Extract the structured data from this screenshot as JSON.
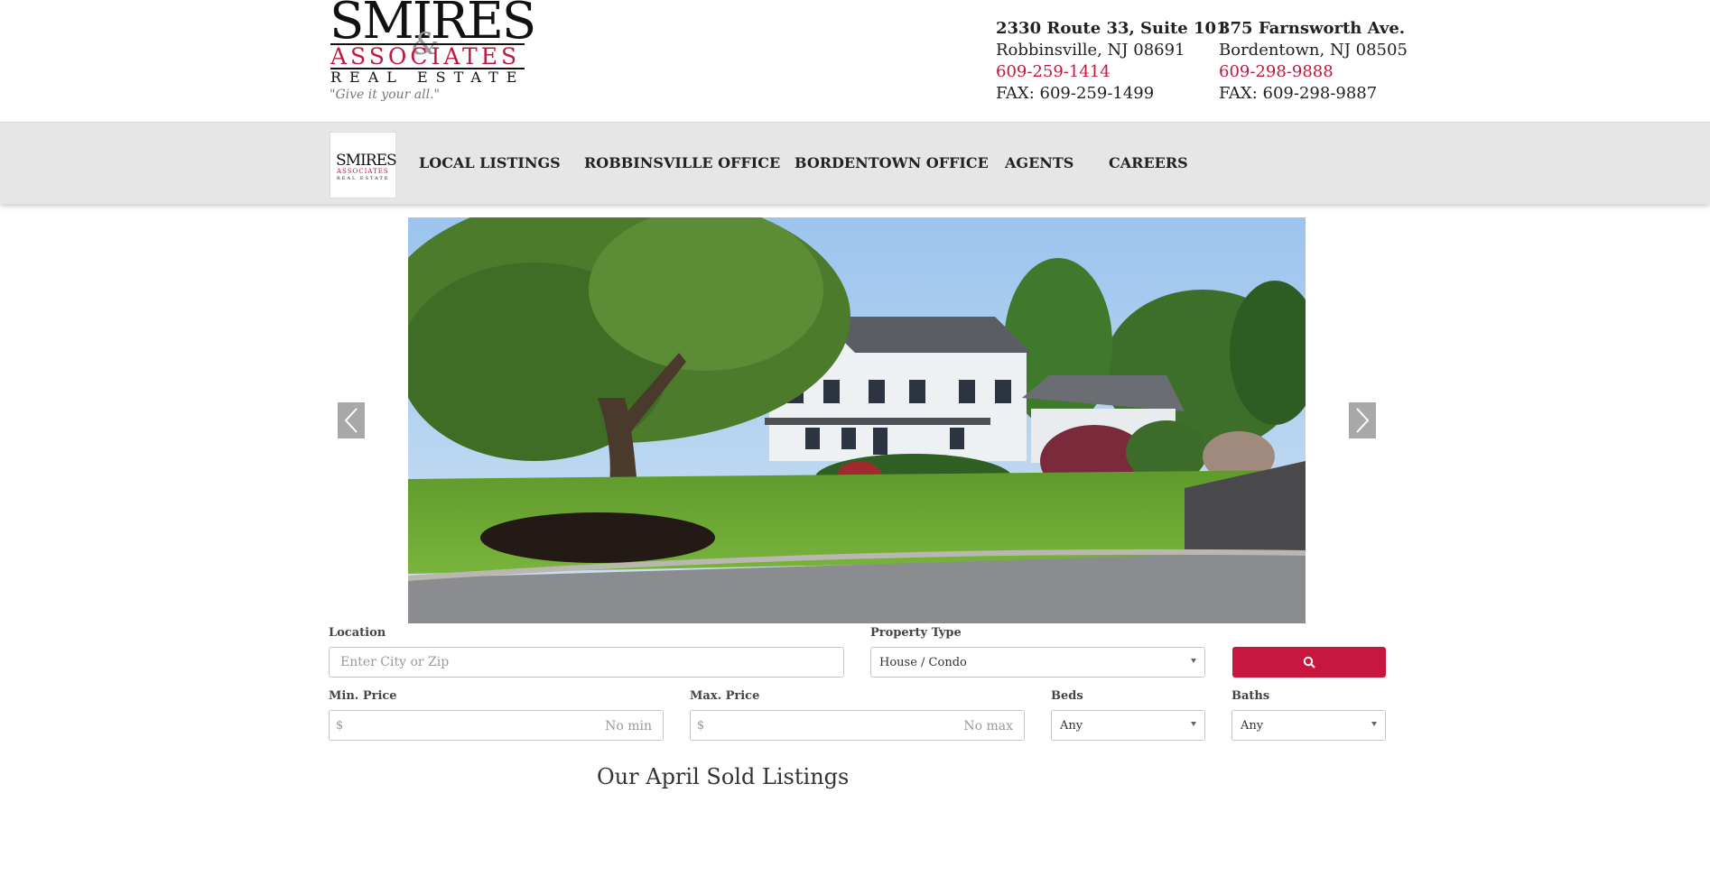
{
  "brand": {
    "logo_main": "SMIRES",
    "logo_amp": "&",
    "logo_sub": "ASSOCIATES",
    "logo_re": "REAL ESTATE",
    "tagline": "\"Give it your all.\"",
    "accent_color": "#c2183f"
  },
  "offices": [
    {
      "address1": "2330 Route 33, Suite 101",
      "address2": "Robbinsville, NJ 08691",
      "phone": "609-259-1414",
      "fax": "FAX: 609-259-1499"
    },
    {
      "address1": "375 Farnsworth Ave.",
      "address2": "Bordentown, NJ 08505",
      "phone": "609-298-9888",
      "fax": "FAX: 609-298-9887"
    }
  ],
  "nav": {
    "items": [
      "LOCAL LISTINGS",
      "ROBBINSVILLE OFFICE",
      "BORDENTOWN OFFICE",
      "AGENTS",
      "CAREERS"
    ]
  },
  "hero": {
    "prev_icon": "chevron-left-icon",
    "next_icon": "chevron-right-icon"
  },
  "search": {
    "location_label": "Location",
    "location_placeholder": "Enter City or Zip",
    "property_type_label": "Property Type",
    "property_type_value": "House / Condo",
    "min_price_label": "Min. Price",
    "min_price_currency": "$",
    "min_price_placeholder": "No min",
    "max_price_label": "Max. Price",
    "max_price_currency": "$",
    "max_price_placeholder": "No max",
    "beds_label": "Beds",
    "beds_value": "Any",
    "baths_label": "Baths",
    "baths_value": "Any",
    "search_icon": "search-icon",
    "button_color": "#c8173f"
  },
  "section": {
    "title": "Our April Sold Listings"
  }
}
